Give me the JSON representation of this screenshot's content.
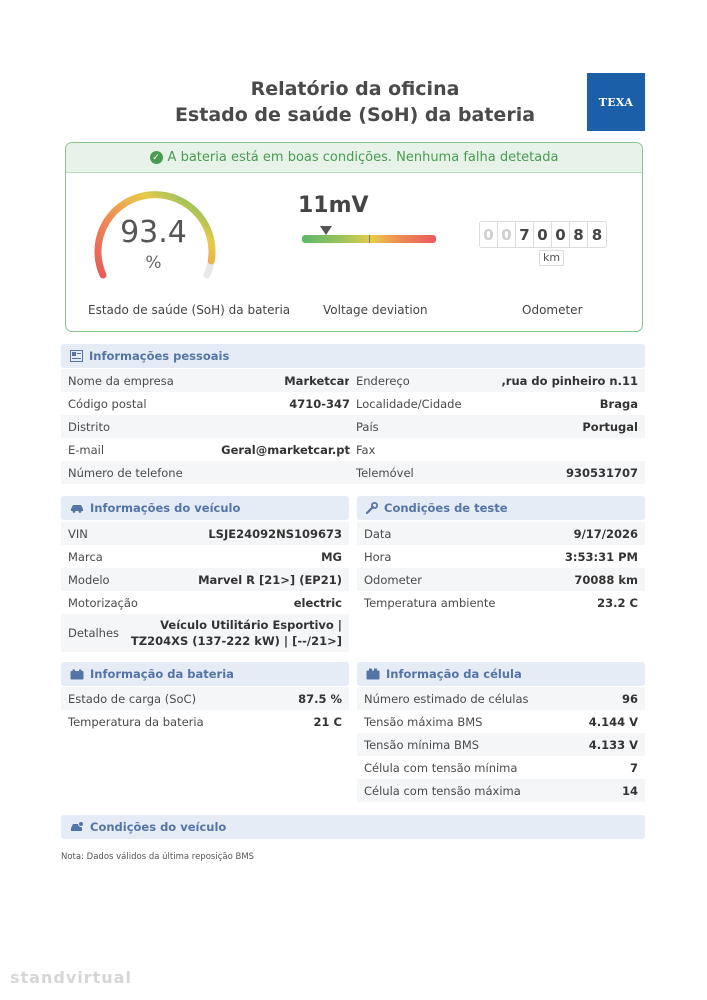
{
  "header": {
    "title_line1": "Relatório da oficina",
    "title_line2": "Estado de saúde (SoH) da bateria",
    "logo_text": "TEXA"
  },
  "status": {
    "message": "A bateria está em boas condições. Nenhuma falha detetada",
    "soh_value": "93.4",
    "soh_unit": "%",
    "soh_fraction": 0.934,
    "soh_label": "Estado de saúde (SoH) da bateria",
    "voltage_deviation": "11mV",
    "voltage_label": "Voltage deviation",
    "odometer_digits": [
      "0",
      "0",
      "7",
      "0",
      "0",
      "8",
      "8"
    ],
    "odometer_unit": "km",
    "odometer_label": "Odometer"
  },
  "personal": {
    "title": "Informações pessoais",
    "left": [
      {
        "label": "Nome da empresa",
        "value": "Marketcar"
      },
      {
        "label": "Código postal",
        "value": "4710-347"
      },
      {
        "label": "Distrito",
        "value": ""
      },
      {
        "label": "E-mail",
        "value": "Geral@marketcar.pt"
      },
      {
        "label": "Número de telefone",
        "value": ""
      }
    ],
    "right": [
      {
        "label": "Endereço",
        "value": ",rua do pinheiro n.11"
      },
      {
        "label": "Localidade/Cidade",
        "value": "Braga"
      },
      {
        "label": "País",
        "value": "Portugal"
      },
      {
        "label": "Fax",
        "value": ""
      },
      {
        "label": "Telemóvel",
        "value": "930531707"
      }
    ]
  },
  "vehicle": {
    "title": "Informações do veículo",
    "rows": [
      {
        "label": "VIN",
        "value": "LSJE24092NS109673"
      },
      {
        "label": "Marca",
        "value": "MG"
      },
      {
        "label": "Modelo",
        "value": "Marvel R [21>] (EP21)"
      },
      {
        "label": "Motorização",
        "value": "electric"
      },
      {
        "label": "Detalhes",
        "value": "Veículo Utilitário Esportivo | TZ204XS (137-222 kW) | [--/21>]"
      }
    ]
  },
  "test": {
    "title": "Condições de teste",
    "rows": [
      {
        "label": "Data",
        "value": "9/17/2026"
      },
      {
        "label": "Hora",
        "value": "3:53:31 PM"
      },
      {
        "label": "Odometer",
        "value": "70088 km"
      },
      {
        "label": "Temperatura ambiente",
        "value": "23.2 C"
      }
    ]
  },
  "battery": {
    "title": "Informação da bateria",
    "rows": [
      {
        "label": "Estado de carga (SoC)",
        "value": "87.5 %"
      },
      {
        "label": "Temperatura da bateria",
        "value": "21 C"
      }
    ]
  },
  "cell": {
    "title": "Informação da célula",
    "rows": [
      {
        "label": "Número estimado de células",
        "value": "96"
      },
      {
        "label": "Tensão máxima BMS",
        "value": "4.144 V"
      },
      {
        "label": "Tensão mínima BMS",
        "value": "4.133 V"
      },
      {
        "label": "Célula com tensão mínima",
        "value": "7"
      },
      {
        "label": "Célula com tensão máxima",
        "value": "14"
      }
    ]
  },
  "vehicle_conditions": {
    "title": "Condições do veículo"
  },
  "note": "Nota: Dados válidos da última reposição BMS",
  "watermark": "standvirtual",
  "colors": {
    "accent_blue": "#5574a6",
    "ok_green": "#4a9b51",
    "logo_blue": "#1b5fa8"
  }
}
